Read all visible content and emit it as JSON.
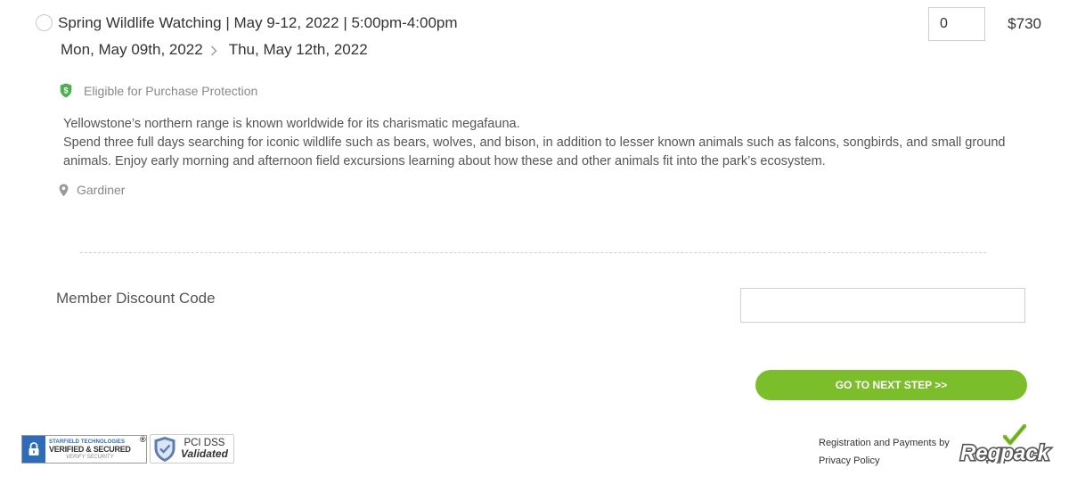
{
  "event": {
    "title": "Spring Wildlife Watching | May 9-12, 2022 | 5:00pm-4:00pm",
    "quantity": "0",
    "price": "$730",
    "start_date": "Mon, May 09th, 2022",
    "end_date": "Thu, May 12th, 2022",
    "protection_text": "Eligible for Purchase Protection",
    "description_line1": "Yellowstone’s northern range is known worldwide for its charismatic megafauna.",
    "description_line2": "Spend three full days searching for iconic wildlife such as bears, wolves, and bison, in addition to lesser known animals such as falcons, songbirds, and small ground animals. Enjoy early morning and afternoon field excursions learning about how these and other animals fit into the park’s ecosystem.",
    "location": "Gardiner"
  },
  "discount": {
    "label": "Member Discount Code",
    "value": "",
    "placeholder": ""
  },
  "next_button_label": "GO TO NEXT STEP >>",
  "badges": {
    "starfield_line1": "STARFIELD TECHNOLOGIES",
    "starfield_line2": "VERIFIED & SECURED",
    "starfield_line3": "VERIFY SECURITY",
    "registered_mark": "®",
    "pci_line1": "PCI DSS",
    "pci_line2": "Validated"
  },
  "footer": {
    "registration_text": "Registration and Payments by",
    "privacy_link": "Privacy Policy",
    "logo_text": "Regpack"
  },
  "icons": {
    "radio": "radio-button-icon",
    "chevron": "chevron-right-icon",
    "protection": "shield-dollar-icon",
    "location": "map-pin-icon",
    "starfield": "lock-icon",
    "pci": "shield-check-icon"
  },
  "colors": {
    "primary_button": "#7cbd2b",
    "protection_shield": "#4caf50",
    "starfield_blue": "#2e6bb8"
  }
}
